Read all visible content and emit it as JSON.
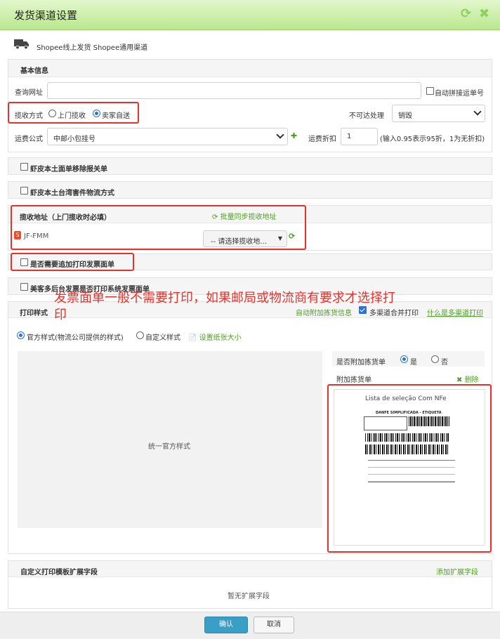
{
  "window": {
    "title": "发货渠道设置"
  },
  "channel": {
    "name": "Shopee线上发货 Shopee通用渠道"
  },
  "basic": {
    "title": "基本信息",
    "query_url_label": "查询网址",
    "query_url_value": "",
    "auto_join_label": "自动拼接运单号",
    "pickup_label": "揽收方式",
    "pickup_opt1": "上门揽收",
    "pickup_opt2": "卖家自送",
    "unreachable_label": "不可达处理",
    "unreachable_value": "销毁",
    "freight_label": "运费公式",
    "freight_value": "中邮小包挂号",
    "discount_label": "运费折扣",
    "discount_value": "1",
    "discount_hint": "(输入0.95表示95折，1为无折扣)"
  },
  "options": {
    "opt1": "虾皮本土面单移除报关单",
    "opt2": "虾皮本土台湾害件物流方式"
  },
  "pickup_addr": {
    "title": "揽收地址（上门揽收时必填）",
    "sync_label": "批量同步揽收地址",
    "store_name": "JF-FMM",
    "select_value": "-- 请选择揽收地..."
  },
  "invoice": {
    "opt1": "是否需要追加打印发票面单",
    "opt2": "美客多后台发票是否打印系统发票面单"
  },
  "annotation": "发票面单一般不需要打印，如果邮局或物流商有要求才选择打印",
  "print": {
    "title": "打印样式",
    "auto_attach": "自动附加拣货信息",
    "multi_merge": "多渠道合并打印",
    "what_is": "什么是多渠道打印",
    "style_official": "官方样式(物流公司提供的样式)",
    "style_custom": "自定义样式",
    "paper_size": "设置纸张大小",
    "preview_text": "统一官方样式",
    "attach_pick_label": "是否附加拣货单",
    "yes": "是",
    "no": "否",
    "attach_pick_title": "附加拣货单",
    "delete": "删除",
    "pick_list_title": "Lista de seleção Com NFe",
    "danfe": "DANFE SIMPLIFICADA - ETIQUETA"
  },
  "custom_fields": {
    "title": "自定义打印模板扩展字段",
    "add": "添加扩展字段",
    "empty": "暂无扩展字段"
  },
  "footer": {
    "confirm": "确认",
    "cancel": "取消"
  },
  "colors": {
    "accent_green": "#4f9d24",
    "annotation_red": "#e8312a",
    "primary_button": "#3a9fc7"
  }
}
